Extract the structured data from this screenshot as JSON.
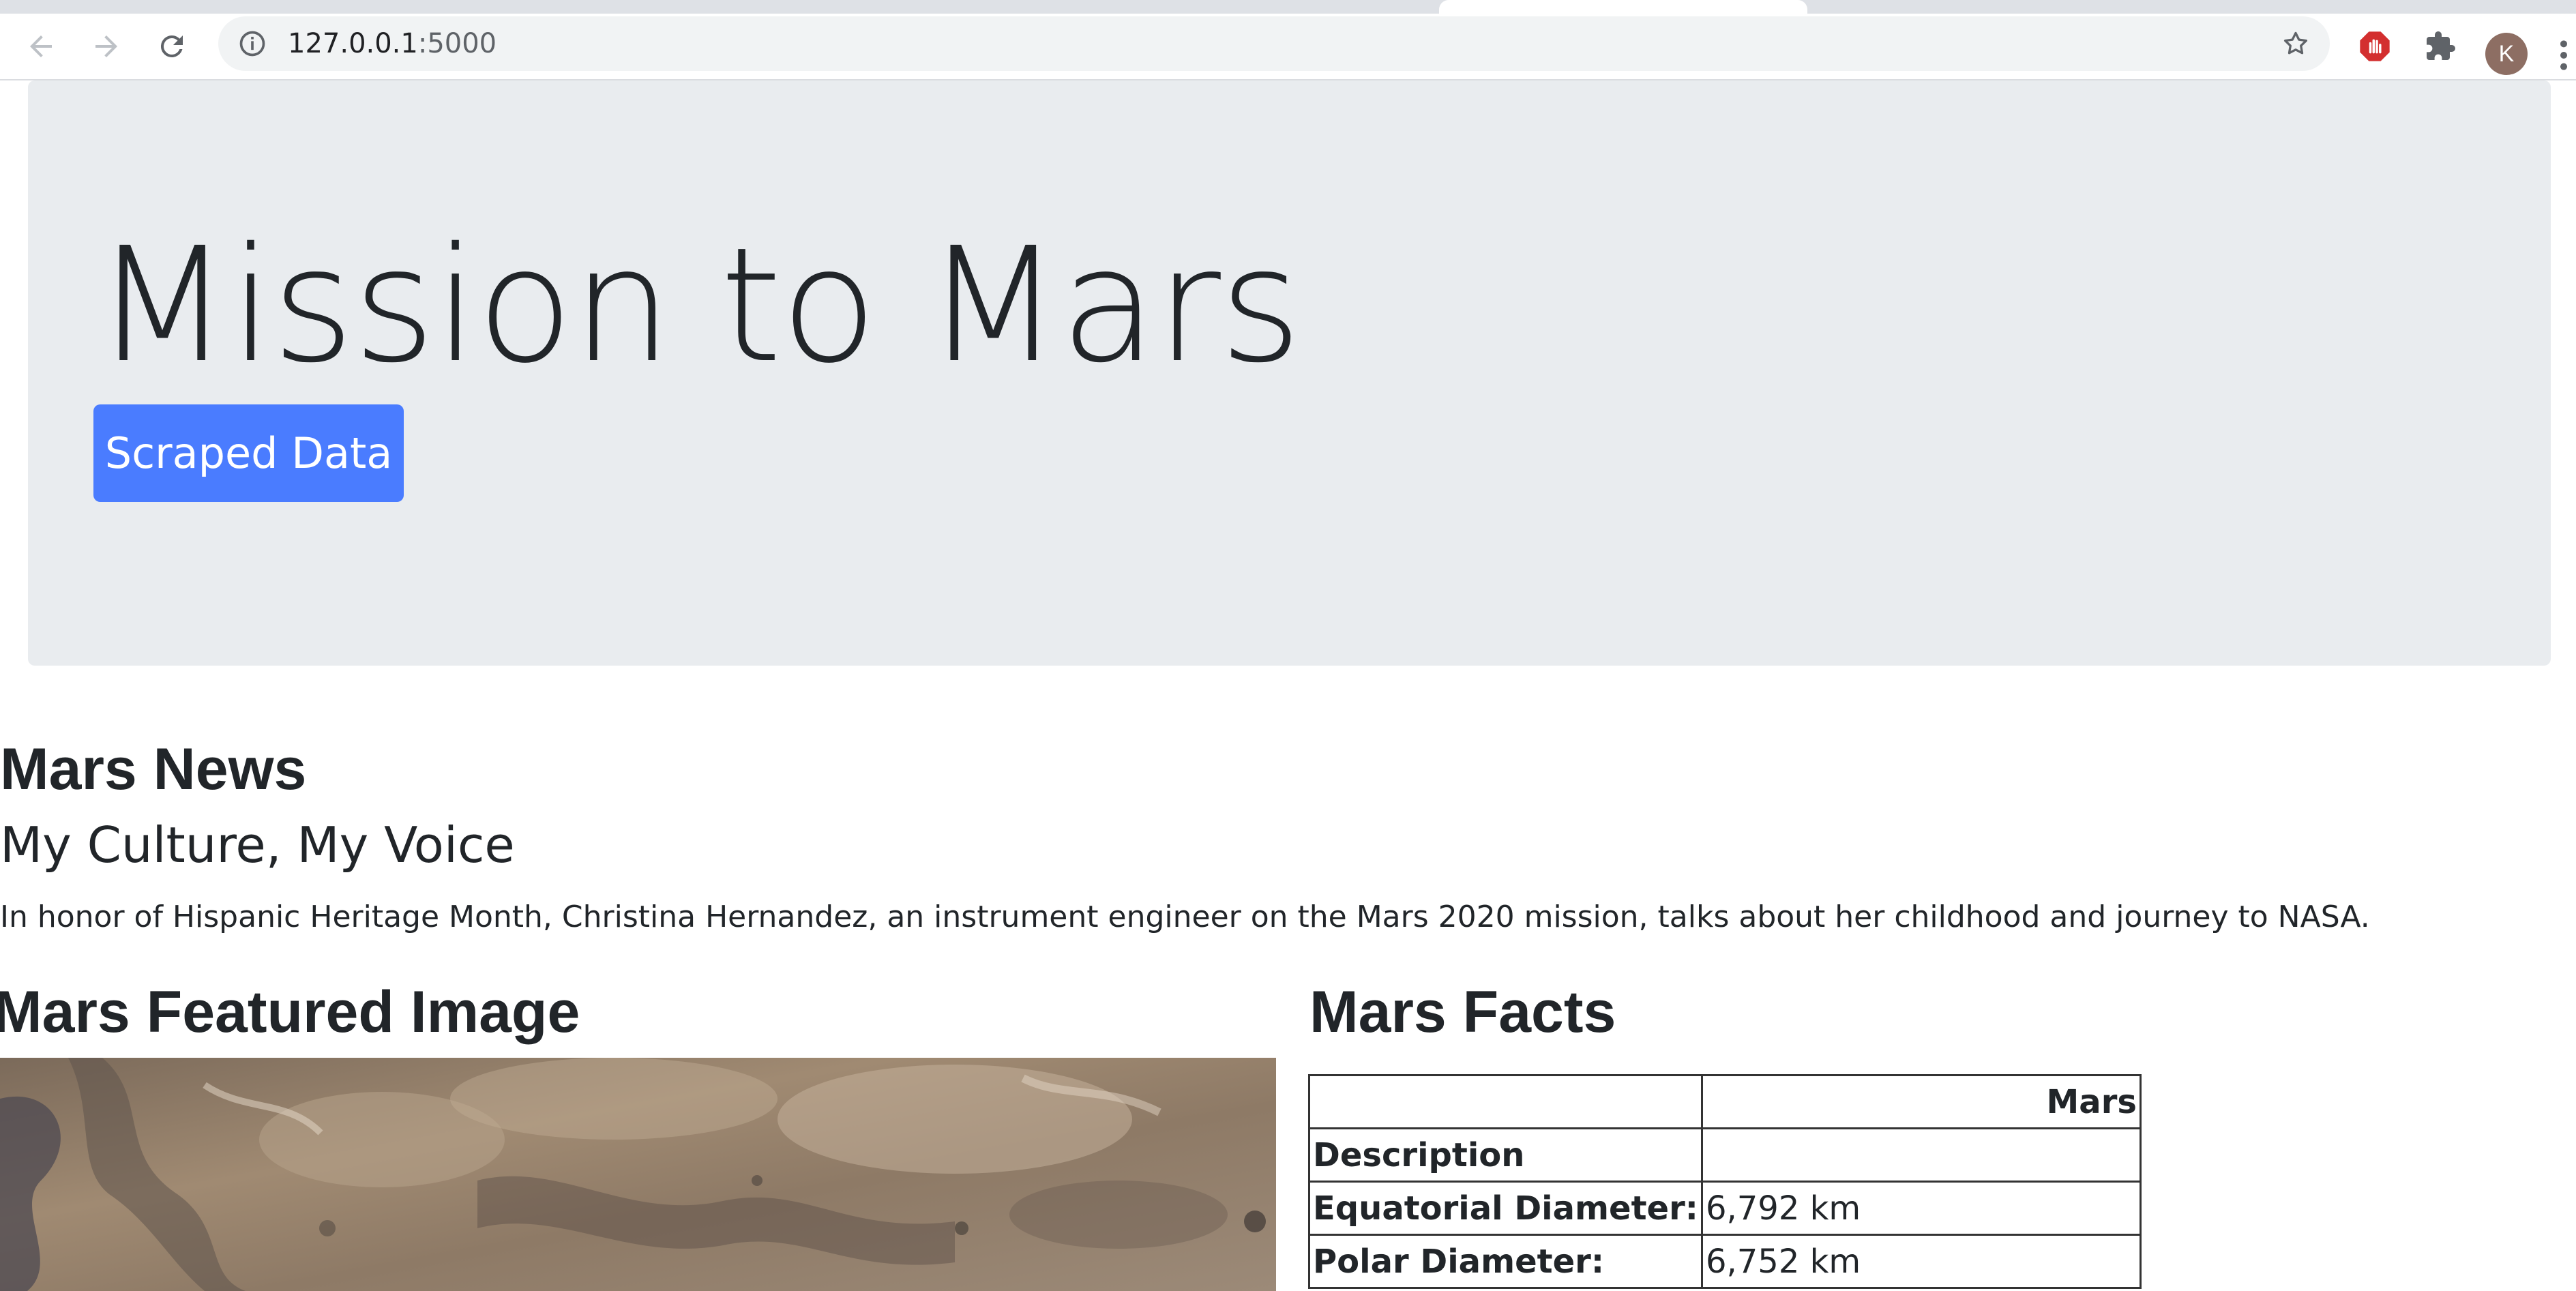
{
  "browser": {
    "url_host": "127.0.0.1",
    "url_port": ":5000",
    "profile_initial": "K"
  },
  "jumbotron": {
    "title": "Mission to Mars",
    "button_label": "Scraped Data"
  },
  "news": {
    "heading": "Mars News",
    "title": "My Culture, My Voice",
    "paragraph": "In honor of Hispanic Heritage Month, Christina Hernandez, an instrument engineer on the Mars 2020 mission, talks about her childhood and journey to NASA."
  },
  "featured": {
    "heading": "Mars Featured Image"
  },
  "facts": {
    "heading": "Mars Facts",
    "column_header": "Mars",
    "rows": [
      {
        "label": "Description",
        "value": ""
      },
      {
        "label": "Equatorial Diameter:",
        "value": "6,792 km"
      },
      {
        "label": "Polar Diameter:",
        "value": "6,752 km"
      }
    ]
  },
  "colors": {
    "button_blue": "#4a7cff",
    "jumbotron_bg": "#e9ecef"
  }
}
